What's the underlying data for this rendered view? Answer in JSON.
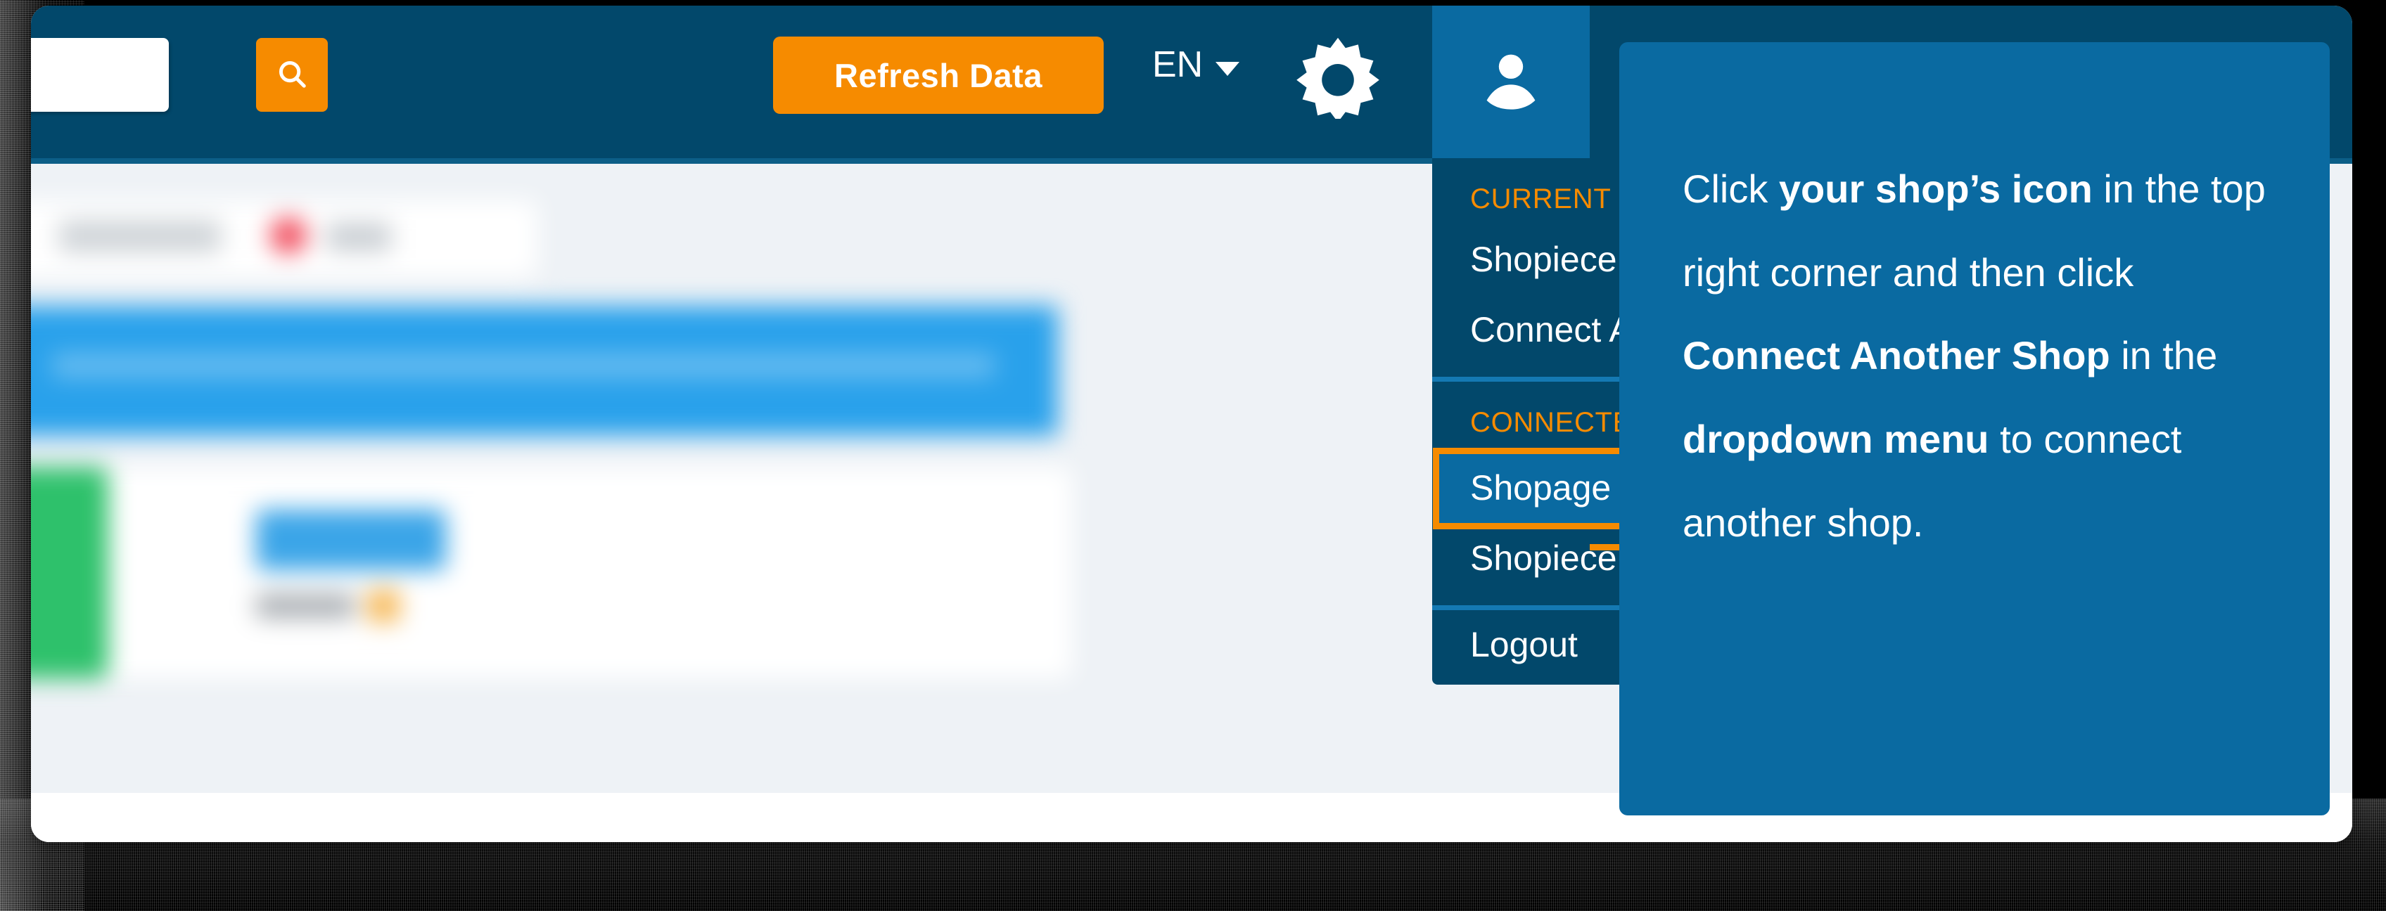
{
  "navbar": {
    "search": {
      "value": "",
      "placeholder": ""
    },
    "search_icon": "search-icon",
    "refresh_label": "Refresh Data",
    "language": {
      "selected": "EN",
      "caret": "chevron-down-icon"
    },
    "settings_icon": "gear-icon",
    "user_icon": "person-icon"
  },
  "dropdown": {
    "current_shop_label": "CURRENT SHOP",
    "current_shop_name": "Shopiece",
    "connect_another_shop": "Connect Another Shop",
    "connected_shops_label": "CONNECTED SHOPS",
    "connected_shops": [
      {
        "name": "Shopage",
        "highlighted": true
      },
      {
        "name": "Shopiece",
        "highlighted": false
      }
    ],
    "logout": "Logout"
  },
  "callout": {
    "parts": [
      {
        "text": "Click ",
        "bold": false
      },
      {
        "text": "your shop’s icon",
        "bold": true
      },
      {
        "text": " in the top right corner and then click ",
        "bold": false
      },
      {
        "text": "Connect Another Shop",
        "bold": true
      },
      {
        "text": " in the ",
        "bold": false
      },
      {
        "text": "dropdown menu",
        "bold": true
      },
      {
        "text": " to connect another shop.",
        "bold": false
      }
    ]
  },
  "colors": {
    "navbar_bg": "#02486b",
    "navbar_border": "#0c5e87",
    "accent_orange": "#F68B00",
    "panel_blue": "#0a6aa1",
    "divider_blue": "#1479b3",
    "page_bg": "#eef2f6"
  }
}
